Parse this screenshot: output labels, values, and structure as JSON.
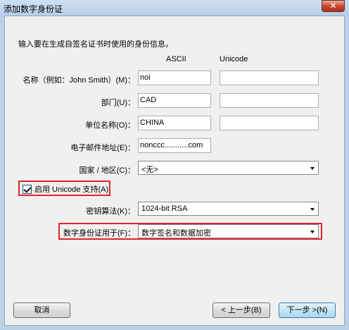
{
  "window": {
    "title": "添加数字身份证",
    "close_glyph": "✕"
  },
  "intro": "输入要在生成自签名证书时使用的身份信息。",
  "columns": {
    "ascii": "ASCII",
    "unicode": "Unicode"
  },
  "fields": {
    "name": {
      "label": "名称（例如：John Smith）(M)：",
      "ascii_value": "noi",
      "unicode_value": ""
    },
    "department": {
      "label": "部门(U)：",
      "ascii_value": "CAD",
      "unicode_value": ""
    },
    "organization": {
      "label": "单位名称(O)：",
      "ascii_value": "CHINA",
      "unicode_value": ""
    },
    "email": {
      "label": "电子邮件地址(E)：",
      "value": "nonccc...........com"
    },
    "country": {
      "label": "国家 / 地区(C)：",
      "value": "<无>"
    }
  },
  "unicode_support": {
    "label": "启用 Unicode 支持(A)",
    "checked": true
  },
  "key_algorithm": {
    "label": "密钥算法(K)：",
    "value": "1024-bit RSA"
  },
  "usage": {
    "label": "数字身份证用于(F)：",
    "value": "数字签名和数据加密"
  },
  "buttons": {
    "cancel": "取消",
    "back": "< 上一步(B)",
    "next": "下一步 >(N)"
  },
  "colors": {
    "highlight": "#e0242b"
  }
}
